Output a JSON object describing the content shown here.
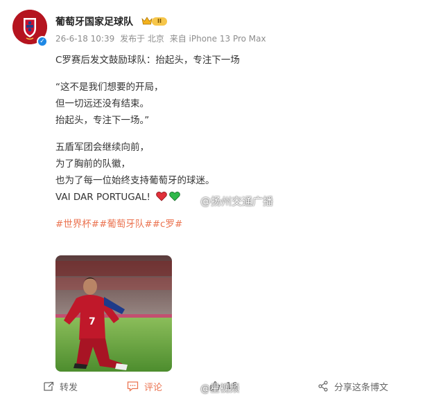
{
  "post": {
    "author": "葡萄牙国家足球队",
    "vip_level": "II",
    "meta": {
      "time": "26-6-18 10:39",
      "location": "发布于 北京",
      "source": "来自 iPhone 13 Pro Max"
    },
    "content": {
      "headline": "C罗赛后发文鼓励球队：抬起头，专注下一场",
      "quote_lines": [
        "“这不是我们想要的开局，",
        "但一切远还没有结束。",
        "抬起头，专注下一场。”"
      ],
      "body_lines": [
        "五盾军团会继续向前，",
        "为了胸前的队徽，",
        "也为了每一位始终支持葡萄牙的球迷。"
      ],
      "closing": "VAI DAR PORTUGAL!",
      "hashtags": "#世界杯##葡萄牙队##c罗#"
    },
    "image_watermark": "@扬州交通广播",
    "bottom_watermark": "@星视频",
    "actions": {
      "repost": "转发",
      "comment": "评论",
      "like_count": "16",
      "share": "分享这条博文"
    },
    "colors": {
      "accent_orange": "#eb7350",
      "verified_blue": "#1e88e5",
      "crest_red": "#b5141f"
    },
    "icons": [
      "portugal-crest-icon",
      "verified-icon",
      "crown-icon",
      "red-heart-icon",
      "green-heart-icon",
      "repost-icon",
      "comment-icon",
      "like-icon",
      "share-icon"
    ]
  }
}
